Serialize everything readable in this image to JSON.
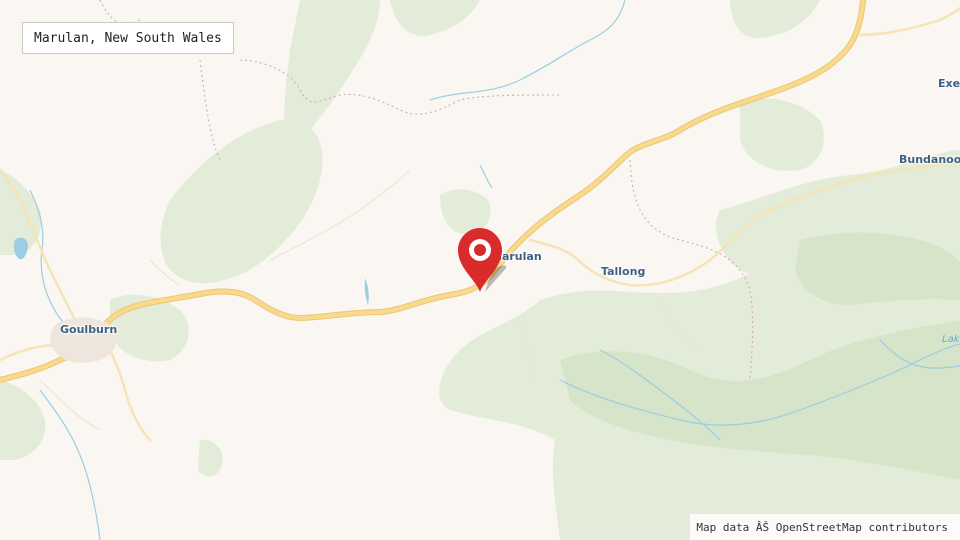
{
  "map": {
    "location_label": "Marulan, New South Wales",
    "attribution": "Map data ÂŠ OpenStreetMap contributors",
    "places": {
      "goulburn": "Goulburn",
      "marulan": "Marulan",
      "tallong": "Tallong",
      "bundanoon": "Bundanoon",
      "exeter": "Exeter"
    },
    "water_labels": {
      "lake": "Lake"
    },
    "marker": {
      "icon": "map-pin-icon",
      "color": "#d92b2b"
    },
    "colors": {
      "land": "#faf7f3",
      "forest": "#e3ecd8",
      "forest_dark": "#d6e4c9",
      "road_major": "#f9d98c",
      "water": "#9ccde2",
      "boundary": "#d9a7b3",
      "label": "#3e5f83"
    }
  }
}
